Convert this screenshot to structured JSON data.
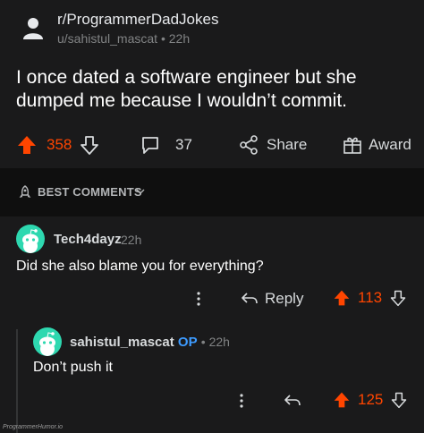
{
  "post": {
    "subreddit": "r/ProgrammerDadJokes",
    "author": "u/sahistul_mascat",
    "age": "22h",
    "title": "I once dated a software engineer but she dumped me because I wouldn’t commit.",
    "votes": "358",
    "comments_count": "37",
    "share_label": "Share",
    "award_label": "Award"
  },
  "comments_header": {
    "label": "BEST COMMENTS"
  },
  "comments": [
    {
      "author": "Tech4dayz",
      "age": "22h",
      "body": "Did she also blame you for everything?",
      "reply_label": "Reply",
      "votes": "113"
    },
    {
      "author": "sahistul_mascat",
      "op_badge": "OP",
      "age": "22h",
      "body": "Don’t push it",
      "votes": "125"
    }
  ],
  "watermark": "ProgrammerHumor.io",
  "colors": {
    "upvote": "#ff4500",
    "op": "#3d9bff",
    "avatar": "#2ed8b0"
  }
}
